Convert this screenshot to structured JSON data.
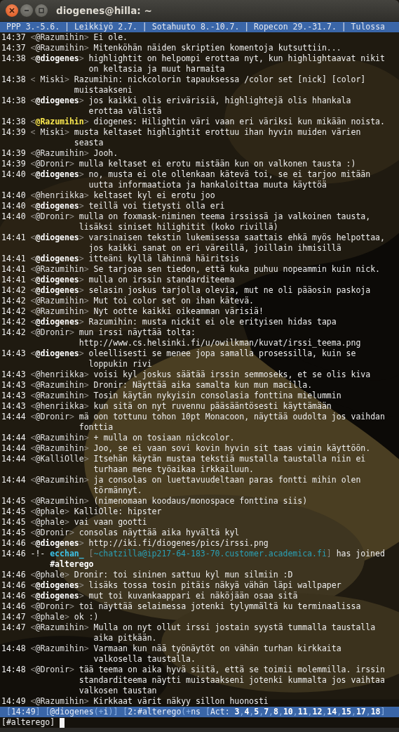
{
  "window": {
    "title": "diogenes@hilla: ~"
  },
  "topic": "PPP 3.-5.6. | Leikkiyö 2.7. | Sotahuuto 8.-10.7. | Ropecon 29.-31.7. | Tulossa",
  "messages": [
    {
      "kind": "message",
      "time": "14:37",
      "open": "<",
      "nick": "@Razumihin",
      "own": false,
      "mention": false,
      "close": ">",
      "lines": [
        "Ei ole."
      ]
    },
    {
      "kind": "message",
      "time": "14:37",
      "open": "<",
      "nick": "@Razumihin",
      "own": false,
      "mention": false,
      "close": ">",
      "lines": [
        "Mitenköhän näiden skriptien komentoja kutsuttiin..."
      ]
    },
    {
      "kind": "message",
      "time": "14:38",
      "open": "<",
      "nick": "@diogenes",
      "own": true,
      "mention": false,
      "close": ">",
      "lines": [
        "highlightit on helpompi erottaa nyt, kun highlightaavat nikit",
        "on keltasia ja muut harmaita"
      ]
    },
    {
      "kind": "message",
      "time": "14:38",
      "open": "<",
      "nick": " Miski",
      "own": false,
      "mention": false,
      "close": ">",
      "lines": [
        "Razumihin: nickcolorin tapauksessa /color set [nick] [color]",
        "muistaakseni"
      ]
    },
    {
      "kind": "message",
      "time": "14:38",
      "open": "<",
      "nick": "@diogenes",
      "own": true,
      "mention": false,
      "close": ">",
      "lines": [
        "jos kaikki olis erivärisiä, highlightejä olis hhankala",
        "erottaa välistä"
      ]
    },
    {
      "kind": "message",
      "time": "14:38",
      "open": "<",
      "nick": "@Razumihin",
      "own": false,
      "mention": true,
      "close": ">",
      "lines": [
        "diogenes: Hilightin väri vaan eri väriksi kun mikään noista."
      ]
    },
    {
      "kind": "message",
      "time": "14:39",
      "open": "<",
      "nick": " Miski",
      "own": false,
      "mention": false,
      "close": ">",
      "lines": [
        "musta keltaset highlightit erottuu ihan hyvin muiden värien",
        "seasta"
      ]
    },
    {
      "kind": "message",
      "time": "14:39",
      "open": "<",
      "nick": "@Razumihin",
      "own": false,
      "mention": false,
      "close": ">",
      "lines": [
        "Jooh."
      ]
    },
    {
      "kind": "message",
      "time": "14:39",
      "open": "<",
      "nick": "@Dronir",
      "own": false,
      "mention": false,
      "close": ">",
      "lines": [
        "mulla keltaset ei erotu mistään kun on valkonen tausta :)"
      ]
    },
    {
      "kind": "message",
      "time": "14:40",
      "open": "<",
      "nick": "@diogenes",
      "own": true,
      "mention": false,
      "close": ">",
      "lines": [
        "no, musta ei ole ollenkaan kätevä toi, se ei tarjoo mitään",
        "uutta informaatiota ja hankaloittaa muuta käyttöä"
      ]
    },
    {
      "kind": "message",
      "time": "14:40",
      "open": "<",
      "nick": "@henriikka",
      "own": false,
      "mention": false,
      "close": ">",
      "lines": [
        "keltaset kyl ei erotu joo"
      ]
    },
    {
      "kind": "message",
      "time": "14:40",
      "open": "<",
      "nick": "@diogenes",
      "own": true,
      "mention": false,
      "close": ">",
      "lines": [
        "teillä voi tietysti olla eri"
      ]
    },
    {
      "kind": "message",
      "time": "14:40",
      "open": "<",
      "nick": "@Dronir",
      "own": false,
      "mention": false,
      "close": ">",
      "lines": [
        "mulla on foxmask-niminen teema irssissä ja valkoinen tausta,",
        "lisäksi siniset hilighitit (koko rivillä)"
      ]
    },
    {
      "kind": "message",
      "time": "14:41",
      "open": "<",
      "nick": "@diogenes",
      "own": true,
      "mention": false,
      "close": ">",
      "lines": [
        "varsinaisen tekstin lukemisessa saattais ehkä myös helpottaa,",
        "jos kaikki sanat on eri väreillä, joillain ihmisillä"
      ]
    },
    {
      "kind": "message",
      "time": "14:41",
      "open": "<",
      "nick": "@diogenes",
      "own": true,
      "mention": false,
      "close": ">",
      "lines": [
        "itteäni kyllä lähinnä häiritsis"
      ]
    },
    {
      "kind": "message",
      "time": "14:41",
      "open": "<",
      "nick": "@Razumihin",
      "own": false,
      "mention": false,
      "close": ">",
      "lines": [
        "Se tarjoaa sen tiedon, että kuka puhuu nopeammin kuin nick."
      ]
    },
    {
      "kind": "message",
      "time": "14:41",
      "open": "<",
      "nick": "@diogenes",
      "own": true,
      "mention": false,
      "close": ">",
      "lines": [
        "mulla on irssin standarditeema"
      ]
    },
    {
      "kind": "message",
      "time": "14:42",
      "open": "<",
      "nick": "@diogenes",
      "own": true,
      "mention": false,
      "close": ">",
      "lines": [
        "selasin joskus tarjolla olevia, mut ne oli pääosin paskoja"
      ]
    },
    {
      "kind": "message",
      "time": "14:42",
      "open": "<",
      "nick": "@Razumihin",
      "own": false,
      "mention": false,
      "close": ">",
      "lines": [
        "Mut toi color set on ihan kätevä."
      ]
    },
    {
      "kind": "message",
      "time": "14:42",
      "open": "<",
      "nick": "@Razumihin",
      "own": false,
      "mention": false,
      "close": ">",
      "lines": [
        "Nyt ootte kaikki oikeamman värisiä!"
      ]
    },
    {
      "kind": "message",
      "time": "14:42",
      "open": "<",
      "nick": "@diogenes",
      "own": true,
      "mention": false,
      "close": ">",
      "lines": [
        "Razumihin: musta nickit ei ole erityisen hidas tapa"
      ]
    },
    {
      "kind": "message",
      "time": "14:42",
      "open": "<",
      "nick": "@Dronir",
      "own": false,
      "mention": false,
      "close": ">",
      "lines": [
        "mun irssi näyttää tolta:",
        "http://www.cs.helsinki.fi/u/owilkman/kuvat/irssi_teema.png"
      ]
    },
    {
      "kind": "message",
      "time": "14:43",
      "open": "<",
      "nick": "@diogenes",
      "own": true,
      "mention": false,
      "close": ">",
      "lines": [
        "oleellisesti se menee jopa samalla prosessilla, kuin se",
        "loppukin rivi"
      ]
    },
    {
      "kind": "message",
      "time": "14:43",
      "open": "<",
      "nick": "@henriikka",
      "own": false,
      "mention": false,
      "close": ">",
      "lines": [
        "voisi kyl joskus säätää irssin semmoseks, et se olis kiva"
      ]
    },
    {
      "kind": "message",
      "time": "14:43",
      "open": "<",
      "nick": "@Razumihin",
      "own": false,
      "mention": false,
      "close": ">",
      "lines": [
        "Dronir: Näyttää aika samalta kun mun macilla."
      ]
    },
    {
      "kind": "message",
      "time": "14:43",
      "open": "<",
      "nick": "@Razumihin",
      "own": false,
      "mention": false,
      "close": ">",
      "lines": [
        "Tosin käytän nykyisin consolasia fonttina mielummin"
      ]
    },
    {
      "kind": "message",
      "time": "14:43",
      "open": "<",
      "nick": "@henriikka",
      "own": false,
      "mention": false,
      "close": ">",
      "lines": [
        "kun sitä on nyt ruvennu pääsääntösesti käyttämään"
      ]
    },
    {
      "kind": "message",
      "time": "14:44",
      "open": "<",
      "nick": "@Dronir",
      "own": false,
      "mention": false,
      "close": ">",
      "lines": [
        "mä oon tottunu tohon 10pt Monacoon, näyttää oudolta jos vaihdan",
        "fonttia"
      ]
    },
    {
      "kind": "message",
      "time": "14:44",
      "open": "<",
      "nick": "@Razumihin",
      "own": false,
      "mention": false,
      "close": ">",
      "lines": [
        "+ mulla on tosiaan nickcolor."
      ]
    },
    {
      "kind": "message",
      "time": "14:44",
      "open": "<",
      "nick": "@Razumihin",
      "own": false,
      "mention": false,
      "close": ">",
      "lines": [
        "Joo, se ei vaan sovi kovin hyvin sit taas vimin käyttöön."
      ]
    },
    {
      "kind": "message",
      "time": "14:44",
      "open": "<",
      "nick": "@KalliOlle",
      "own": false,
      "mention": false,
      "close": ">",
      "lines": [
        "Itsehän käytän mustaa tekstiä mustalla taustalla niin ei",
        "turhaan mene työaikaa irkkailuun."
      ]
    },
    {
      "kind": "message",
      "time": "14:44",
      "open": "<",
      "nick": "@Razumihin",
      "own": false,
      "mention": false,
      "close": ">",
      "lines": [
        "ja consolas on luettavuudeltaan paras fontti mihin olen",
        "törmännyt."
      ]
    },
    {
      "kind": "message",
      "time": "14:45",
      "open": "<",
      "nick": "@Razumihin",
      "own": false,
      "mention": false,
      "close": ">",
      "lines": [
        "(nimenomaan koodaus/monospace fonttina siis)"
      ]
    },
    {
      "kind": "message",
      "time": "14:45",
      "open": "<",
      "nick": "@phale",
      "own": false,
      "mention": false,
      "close": ">",
      "lines": [
        "KalliOlle: hipster"
      ]
    },
    {
      "kind": "message",
      "time": "14:45",
      "open": "<",
      "nick": "@phale",
      "own": false,
      "mention": false,
      "close": ">",
      "lines": [
        "vai vaan gootti"
      ]
    },
    {
      "kind": "message",
      "time": "14:45",
      "open": "<",
      "nick": "@Dronir",
      "own": false,
      "mention": false,
      "close": ">",
      "lines": [
        "consolas näyttää aika hyvältä kyl"
      ]
    },
    {
      "kind": "message",
      "time": "14:46",
      "open": "<",
      "nick": "@diogenes",
      "own": true,
      "mention": false,
      "close": ">",
      "lines": [
        "http://iki.fi/diogenes/pics/irssi.png"
      ]
    },
    {
      "kind": "join",
      "time": "14:46",
      "marker": "-!-",
      "nick": "ecchan_",
      "host_open": "[",
      "host": "~chatzilla@ip217-64-183-70.customer.academica.fi",
      "host_close": "]",
      "action": "has joined",
      "channel": "#alterego"
    },
    {
      "kind": "message",
      "time": "14:46",
      "open": "<",
      "nick": "@phale",
      "own": false,
      "mention": false,
      "close": ">",
      "lines": [
        "Dronir: toi sininen sattuu kyl mun silmiin :D"
      ]
    },
    {
      "kind": "message",
      "time": "14:46",
      "open": "<",
      "nick": "@diogenes",
      "own": true,
      "mention": false,
      "close": ">",
      "lines": [
        "lisäks tossa tosin pitäis näkyä vähän läpi wallpaper"
      ]
    },
    {
      "kind": "message",
      "time": "14:46",
      "open": "<",
      "nick": "@diogenes",
      "own": true,
      "mention": false,
      "close": ">",
      "lines": [
        "mut toi kuvankaappari ei näköjään osaa sitä"
      ]
    },
    {
      "kind": "message",
      "time": "14:46",
      "open": "<",
      "nick": "@Dronir",
      "own": false,
      "mention": false,
      "close": ">",
      "lines": [
        "toi näyttää selaimessa jotenki tylymmältä ku terminaalissa"
      ]
    },
    {
      "kind": "message",
      "time": "14:47",
      "open": "<",
      "nick": "@phale",
      "own": false,
      "mention": false,
      "close": ">",
      "lines": [
        "ok :)"
      ]
    },
    {
      "kind": "message",
      "time": "14:47",
      "open": "<",
      "nick": "@Razumihin",
      "own": false,
      "mention": false,
      "close": ">",
      "lines": [
        "Mulla on nyt ollut irssi jostain syystä tummalla taustalla",
        "aika pitkään."
      ]
    },
    {
      "kind": "message",
      "time": "14:48",
      "open": "<",
      "nick": "@Razumihin",
      "own": false,
      "mention": false,
      "close": ">",
      "lines": [
        "Varmaan kun nää työnäytöt on vähän turhan kirkkaita",
        "valkosella taustalla."
      ]
    },
    {
      "kind": "message",
      "time": "14:48",
      "open": "<",
      "nick": "@Dronir",
      "own": false,
      "mention": false,
      "close": ">",
      "lines": [
        "tää teema on aika hyvä siitä, että se toimii molemmilla. irssin",
        "standarditeema näytti muistaakseni jotenki kummalta jos vaihtaa",
        "valkosen taustan"
      ]
    },
    {
      "kind": "message",
      "time": "14:49",
      "open": "<",
      "nick": "@Razumihin",
      "own": false,
      "mention": false,
      "close": ">",
      "lines": [
        "Kirkkaat värit näkyy sillon huonosti"
      ]
    }
  ],
  "status_bar": {
    "segments": [
      {
        "text": "[",
        "kind": "punct"
      },
      {
        "text": "14:49",
        "kind": "text"
      },
      {
        "text": "] [",
        "kind": "punct"
      },
      {
        "text": "@diogenes",
        "kind": "text"
      },
      {
        "text": "(+",
        "kind": "punct"
      },
      {
        "text": "i",
        "kind": "text"
      },
      {
        "text": ")] [",
        "kind": "punct"
      },
      {
        "text": "2:#alterego",
        "kind": "text"
      },
      {
        "text": "(+",
        "kind": "punct"
      },
      {
        "text": "ns",
        "kind": "text"
      },
      {
        "text": " [",
        "kind": "punct"
      },
      {
        "text": "Act: ",
        "kind": "text"
      },
      {
        "text": "3",
        "kind": "activity"
      },
      {
        "text": ",",
        "kind": "punct"
      },
      {
        "text": "4",
        "kind": "activity"
      },
      {
        "text": ",",
        "kind": "punct"
      },
      {
        "text": "5",
        "kind": "activity"
      },
      {
        "text": ",",
        "kind": "punct"
      },
      {
        "text": "7",
        "kind": "activity"
      },
      {
        "text": ",",
        "kind": "punct"
      },
      {
        "text": "8",
        "kind": "activity"
      },
      {
        "text": ",",
        "kind": "punct"
      },
      {
        "text": "10",
        "kind": "activity"
      },
      {
        "text": ",",
        "kind": "punct"
      },
      {
        "text": "11",
        "kind": "activity"
      },
      {
        "text": ",",
        "kind": "punct"
      },
      {
        "text": "12",
        "kind": "activity"
      },
      {
        "text": ",",
        "kind": "punct"
      },
      {
        "text": "14",
        "kind": "activity"
      },
      {
        "text": ",",
        "kind": "punct"
      },
      {
        "text": "15",
        "kind": "activity"
      },
      {
        "text": ",",
        "kind": "punct"
      },
      {
        "text": "17",
        "kind": "activity"
      },
      {
        "text": ",",
        "kind": "punct"
      },
      {
        "text": "18",
        "kind": "activity"
      },
      {
        "text": "]",
        "kind": "punct"
      }
    ]
  },
  "input": {
    "prompt": "[#alterego]"
  }
}
